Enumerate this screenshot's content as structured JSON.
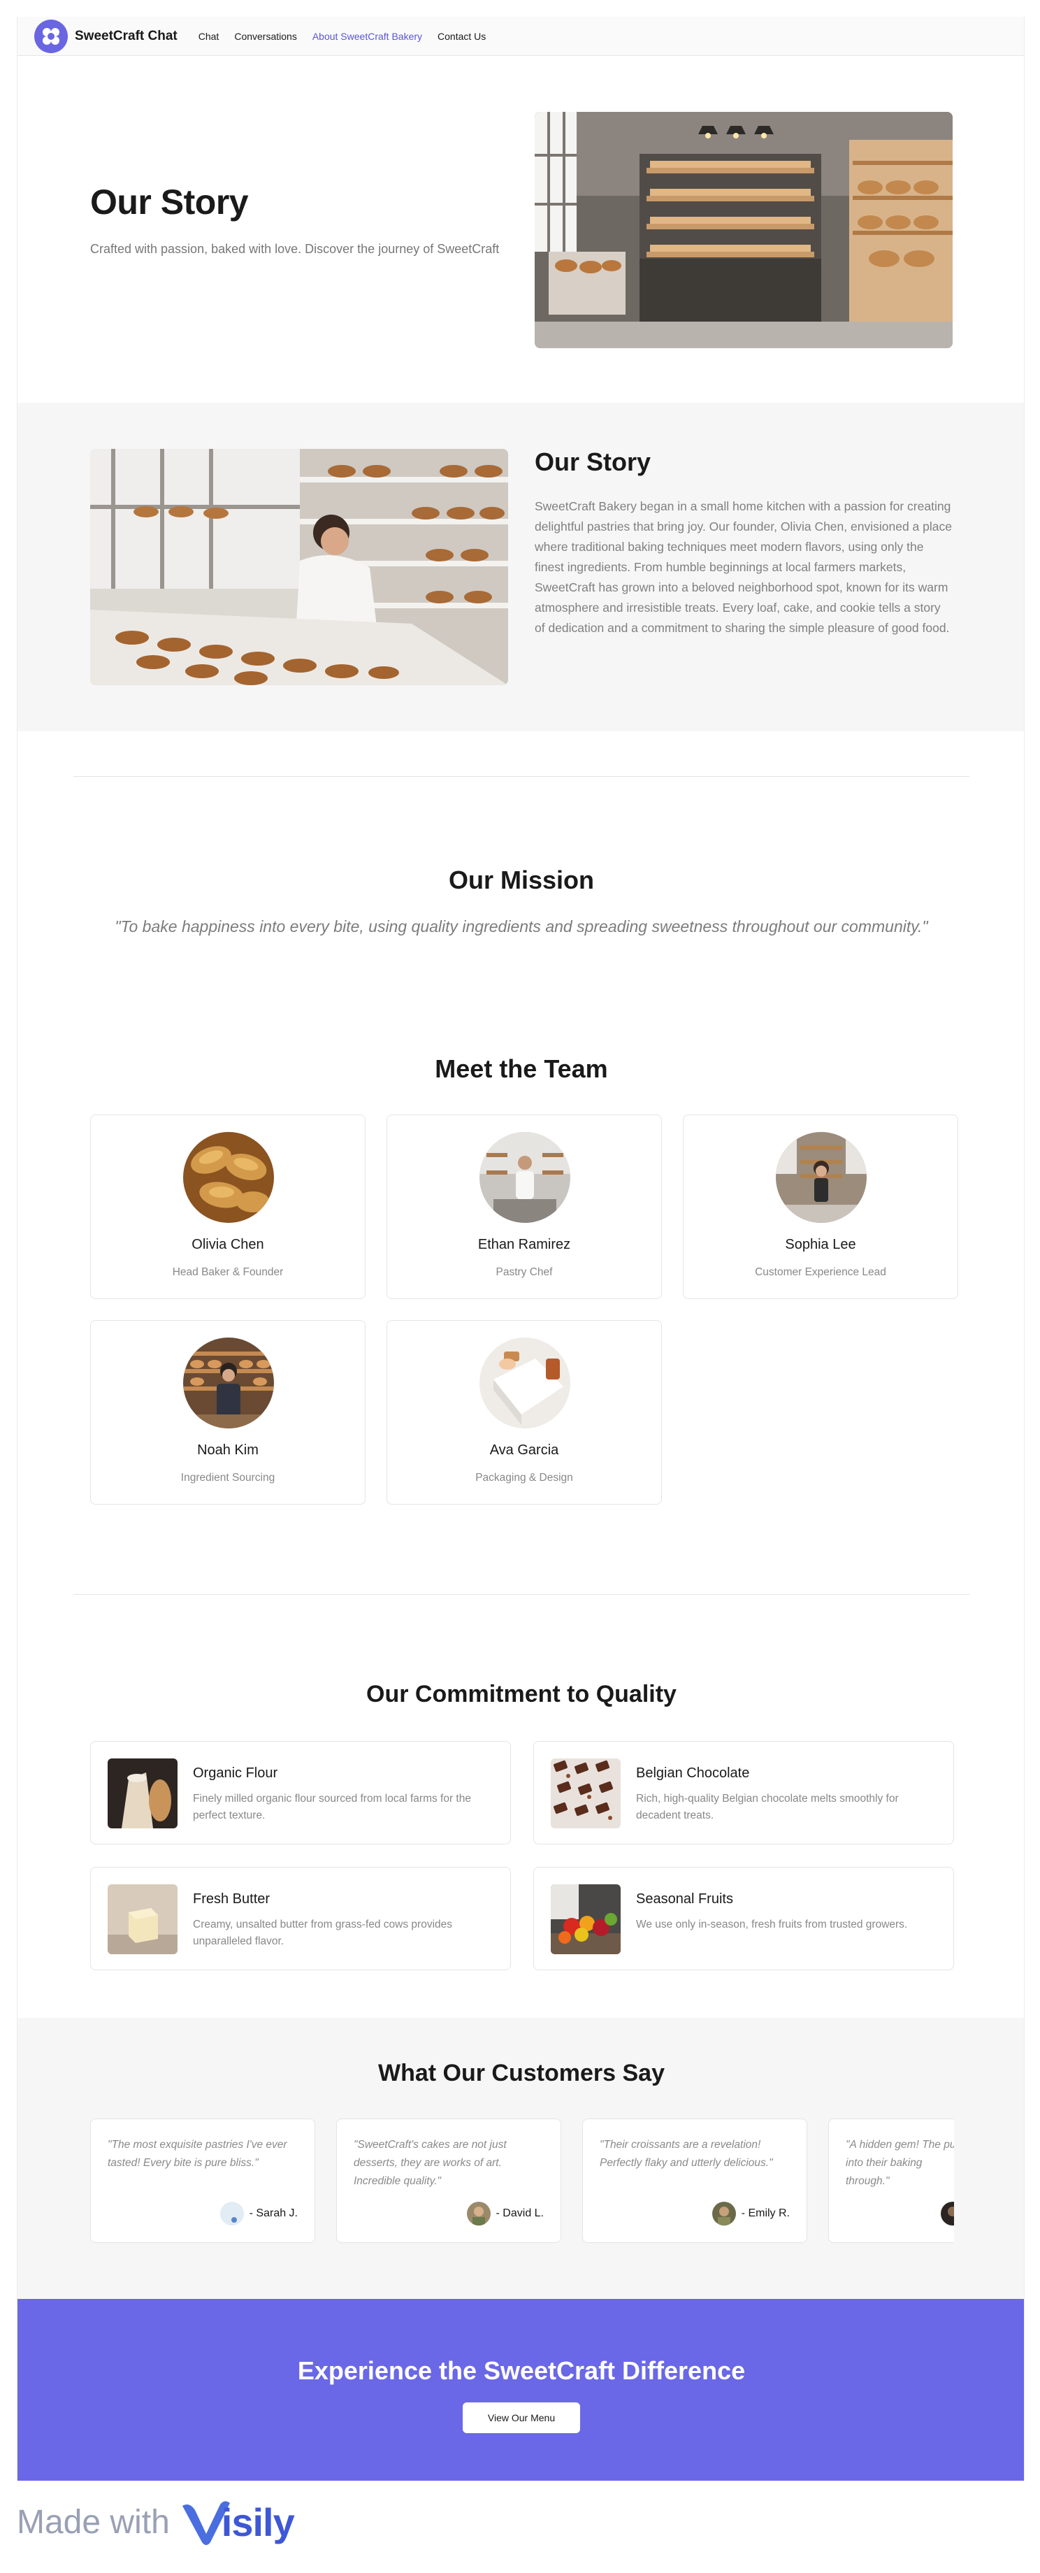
{
  "nav": {
    "brand": "SweetCraft Chat",
    "links": [
      "Chat",
      "Conversations",
      "About SweetCraft Bakery",
      "Contact Us"
    ],
    "active_index": 2
  },
  "hero": {
    "title": "Our Story",
    "subtitle": "Crafted with passion, baked with love. Discover the journey of SweetCraft"
  },
  "story": {
    "title": "Our Story",
    "text": "SweetCraft Bakery began in a small home kitchen with a passion for creating delightful pastries that bring joy. Our founder, Olivia Chen, envisioned a place where traditional baking techniques meet modern flavors, using only the finest ingredients. From humble beginnings at local farmers markets, SweetCraft has grown into a beloved neighborhood spot, known for its warm atmosphere and irresistible treats. Every loaf, cake, and cookie tells a story of dedication and a commitment to sharing the simple pleasure of good food."
  },
  "mission": {
    "title": "Our Mission",
    "quote": "\"To bake happiness into every bite, using quality ingredients and spreading sweetness throughout our community.\""
  },
  "team": {
    "title": "Meet the Team",
    "members": [
      {
        "name": "Olivia Chen",
        "role": "Head Baker & Founder"
      },
      {
        "name": "Ethan Ramirez",
        "role": "Pastry Chef"
      },
      {
        "name": "Sophia Lee",
        "role": "Customer Experience Lead"
      },
      {
        "name": "Noah Kim",
        "role": "Ingredient Sourcing"
      },
      {
        "name": "Ava Garcia",
        "role": "Packaging & Design"
      }
    ]
  },
  "quality": {
    "title": "Our Commitment to Quality",
    "items": [
      {
        "name": "Organic Flour",
        "desc": "Finely milled organic flour sourced from local farms for the perfect texture."
      },
      {
        "name": "Belgian Chocolate",
        "desc": "Rich, high-quality Belgian chocolate melts smoothly for decadent treats."
      },
      {
        "name": "Fresh Butter",
        "desc": "Creamy, unsalted butter from grass-fed cows provides unparalleled flavor."
      },
      {
        "name": "Seasonal Fruits",
        "desc": "We use only in-season, fresh fruits from trusted growers."
      }
    ]
  },
  "testimonials": {
    "title": "What Our Customers Say",
    "items": [
      {
        "quote": "\"The most exquisite pastries I've ever tasted! Every bite is pure bliss.\"",
        "author": "- Sarah J."
      },
      {
        "quote": "\"SweetCraft's cakes are not just desserts, they are works of art. Incredible quality.\"",
        "author": "- David L."
      },
      {
        "quote": "\"Their croissants are a revelation! Perfectly flaky and utterly delicious.\"",
        "author": "- Emily R."
      },
      {
        "quote": "\"A hidden gem! The put into their baking through.\"",
        "author": ""
      }
    ]
  },
  "cta": {
    "title": "Experience the SweetCraft Difference",
    "button": "View Our Menu"
  },
  "footer": {
    "made_with": "Made with",
    "visily": "isily"
  },
  "colors": {
    "accent": "#6a68e6",
    "active_link": "#5a55d6",
    "band_bg": "#f6f6f6"
  }
}
